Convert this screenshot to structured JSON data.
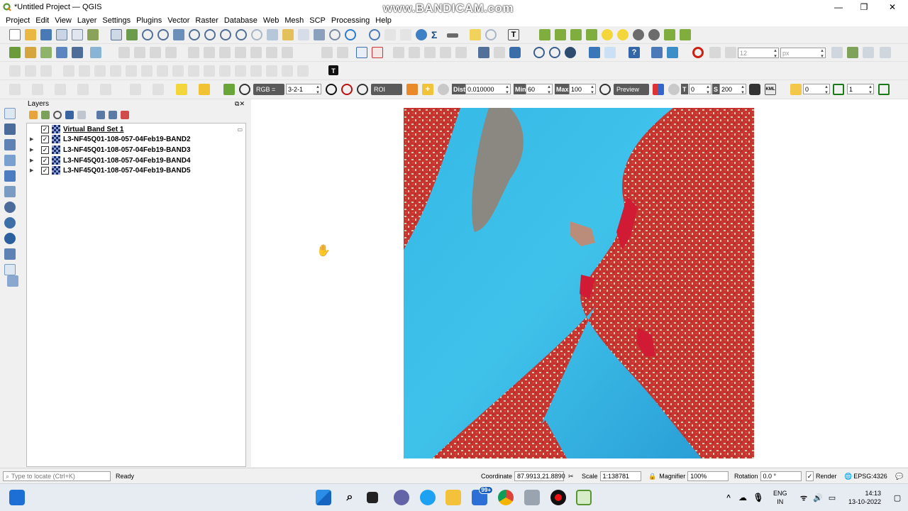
{
  "app": {
    "title": "*Untitled Project — QGIS",
    "watermark": "www.BANDICAM.com",
    "accent": "#589632"
  },
  "window_controls": {
    "minimize": "—",
    "maximize": "❐",
    "close": "✕"
  },
  "menu": [
    "Project",
    "Edit",
    "View",
    "Layer",
    "Settings",
    "Plugins",
    "Vector",
    "Raster",
    "Database",
    "Web",
    "Mesh",
    "SCP",
    "Processing",
    "Help"
  ],
  "toolbar2": {
    "font_size": "12",
    "unit": "px"
  },
  "scp_toolbar": {
    "rgb_label": "RGB =",
    "rgb_value": "3-2-1",
    "roi_label": "ROI",
    "dist_label": "Dist",
    "dist_value": "0.010000",
    "min_label": "Min",
    "min_value": "60",
    "max_label": "Max",
    "max_value": "100",
    "preview_label": "Preview",
    "t_label": "T",
    "t_value": "0",
    "s_label": "S",
    "s_value": "200",
    "band_value": "0",
    "num_value": "1",
    "kml_label": "KML"
  },
  "layers_panel": {
    "title": "Layers",
    "items": [
      {
        "label": "Virtual Band Set 1",
        "checked": true,
        "group": true
      },
      {
        "label": "L3-NF45Q01-108-057-04Feb19-BAND2",
        "checked": true
      },
      {
        "label": "L3-NF45Q01-108-057-04Feb19-BAND3",
        "checked": true
      },
      {
        "label": "L3-NF45Q01-108-057-04Feb19-BAND4",
        "checked": true
      },
      {
        "label": "L3-NF45Q01-108-057-04Feb19-BAND5",
        "checked": true
      }
    ]
  },
  "statusbar": {
    "locate_placeholder": "Type to locate (Ctrl+K)",
    "ready": "Ready",
    "coordinate_label": "Coordinate",
    "coordinate_value": "87.9913,21.8890",
    "scale_label": "Scale",
    "scale_value": "1:138781",
    "magnifier_label": "Magnifier",
    "magnifier_value": "100%",
    "rotation_label": "Rotation",
    "rotation_value": "0.0 °",
    "render_label": "Render",
    "crs": "EPSG:4326"
  },
  "taskbar": {
    "lang_line1": "ENG",
    "lang_line2": "IN",
    "time": "14:13",
    "date": "13-10-2022",
    "mail_badge": "99+"
  }
}
